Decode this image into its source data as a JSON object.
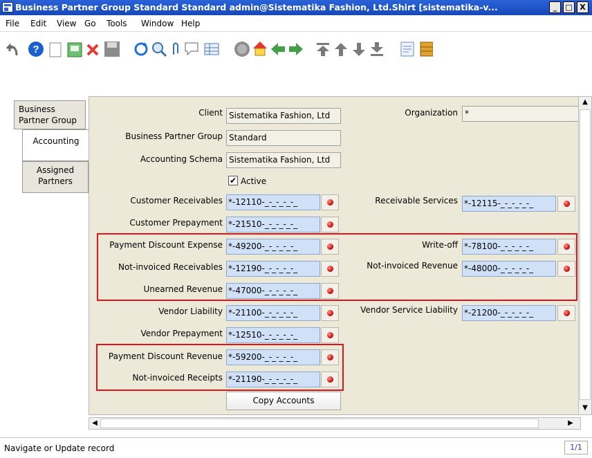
{
  "window": {
    "title": "Business Partner Group  Standard  Standard  admin@Sistematika Fashion, Ltd.Shirt [sistematika-v...",
    "controls": [
      "_",
      "□",
      "X"
    ]
  },
  "menu": {
    "items": [
      "File",
      "Edit",
      "View",
      "Go",
      "Tools",
      "Window",
      "Help"
    ]
  },
  "toolbar": {
    "icons": [
      "undo-icon",
      "help-icon",
      "new-record-icon",
      "copy-record-icon",
      "delete-icon",
      "save-icon",
      "refresh-icon",
      "find-icon",
      "attachment-icon",
      "chat-icon",
      "grid-toggle-icon",
      "history-icon",
      "home-icon",
      "back-icon",
      "forward-icon",
      "first-record-icon",
      "previous-record-icon",
      "next-record-icon",
      "last-record-icon",
      "report-icon",
      "archive-icon"
    ]
  },
  "tabs": [
    {
      "label": "Business Partner Group",
      "selected": false
    },
    {
      "label": "Accounting",
      "selected": true
    },
    {
      "label": "Assigned Partners",
      "selected": false
    }
  ],
  "form": {
    "client_label": "Client",
    "client_value": "Sistematika Fashion, Ltd",
    "org_label": "Organization",
    "org_value": "*",
    "bpgroup_label": "Business Partner Group",
    "bpgroup_value": "Standard",
    "schema_label": "Accounting Schema",
    "schema_value": "Sistematika Fashion, Ltd",
    "active_label": "Active",
    "active_checked": true,
    "cust_recv_label": "Customer Receivables",
    "cust_recv_value": "*-12110-_-_-_-_-_",
    "recv_services_label": "Receivable Services",
    "recv_services_value": "*-12115-_-_-_-_-_",
    "cust_prepay_label": "Customer Prepayment",
    "cust_prepay_value": "*-21510-_-_-_-_-_",
    "pay_disc_exp_label": "Payment Discount Expense",
    "pay_disc_exp_value": "*-49200-_-_-_-_-_",
    "writeoff_label": "Write-off",
    "writeoff_value": "*-78100-_-_-_-_-_",
    "notinv_recv_label": "Not-invoiced Receivables",
    "notinv_recv_value": "*-12190-_-_-_-_-_",
    "notinv_rev_label": "Not-invoiced Revenue",
    "notinv_rev_value": "*-48000-_-_-_-_-_",
    "unearned_label": "Unearned Revenue",
    "unearned_value": "*-47000-_-_-_-_-_",
    "vendor_liab_label": "Vendor Liability",
    "vendor_liab_value": "*-21100-_-_-_-_-_",
    "vendor_svc_liab_label": "Vendor Service Liability",
    "vendor_svc_liab_value": "*-21200-_-_-_-_-_",
    "vendor_prepay_label": "Vendor Prepayment",
    "vendor_prepay_value": "*-12510-_-_-_-_-_",
    "pay_disc_rev_label": "Payment Discount Revenue",
    "pay_disc_rev_value": "*-59200-_-_-_-_-_",
    "notinv_receipts_label": "Not-invoiced Receipts",
    "notinv_receipts_value": "*-21190-_-_-_-_-_",
    "copy_accounts_label": "Copy Accounts"
  },
  "status": {
    "message": "Navigate or Update record",
    "record_count": "1/1"
  },
  "colors": {
    "titlebar": "#1f55c8",
    "account_field": "#cfe0f7",
    "highlight_box": "#e0141a",
    "panel_bg": "#ece9d8"
  }
}
